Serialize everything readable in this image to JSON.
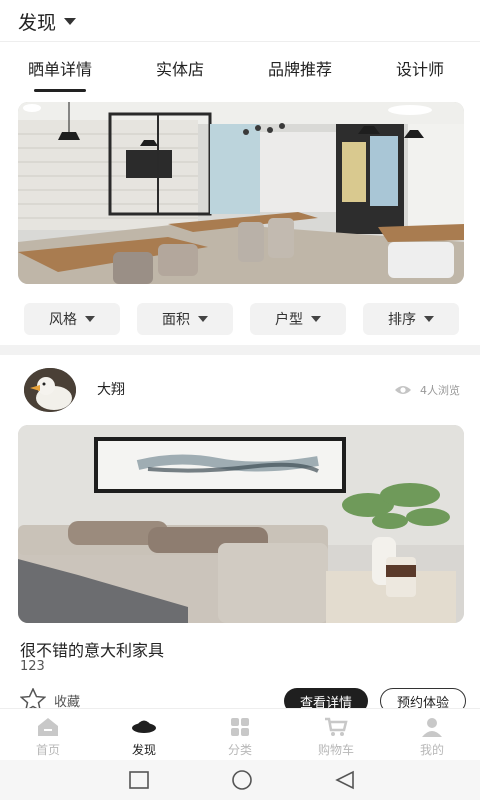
{
  "header": {
    "title": "发现"
  },
  "tabs": [
    {
      "label": "晒单详情",
      "active": true
    },
    {
      "label": "实体店",
      "active": false
    },
    {
      "label": "品牌推荐",
      "active": false
    },
    {
      "label": "设计师",
      "active": false
    }
  ],
  "filters": [
    {
      "label": "风格"
    },
    {
      "label": "面积"
    },
    {
      "label": "户型"
    },
    {
      "label": "排序"
    }
  ],
  "post": {
    "username": "大翔",
    "views": "4人浏览",
    "title": "很不错的意大利家具",
    "subtitle": "123",
    "favorite_label": "收藏",
    "details_button": "查看详情",
    "book_button": "预约体验"
  },
  "bottom_nav": [
    {
      "label": "首页",
      "icon": "home-icon",
      "active": false
    },
    {
      "label": "发现",
      "icon": "discover-icon",
      "active": true
    },
    {
      "label": "分类",
      "icon": "category-icon",
      "active": false
    },
    {
      "label": "购物车",
      "icon": "cart-icon",
      "active": false
    },
    {
      "label": "我的",
      "icon": "profile-icon",
      "active": false
    }
  ],
  "colors": {
    "accent_dark": "#1f1f1f",
    "inactive_nav": "#b8b8b8"
  }
}
